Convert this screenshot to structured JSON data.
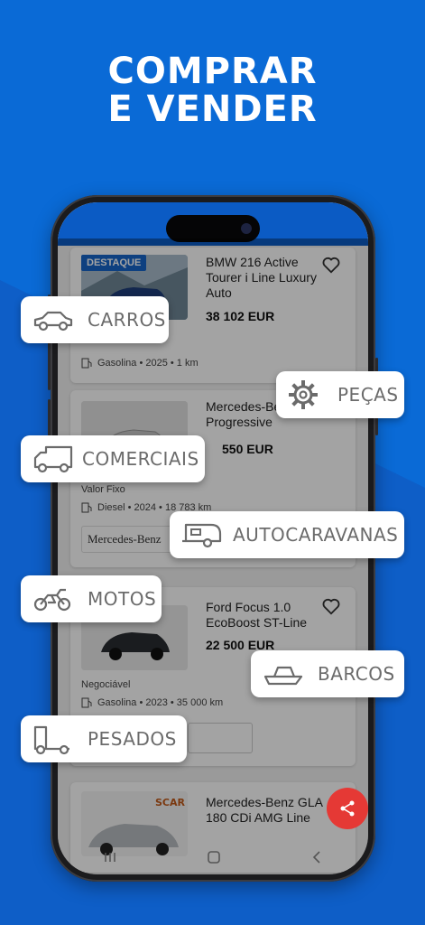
{
  "headline": {
    "line1": "COMPRAR",
    "line2": "E VENDER"
  },
  "colors": {
    "background": "#0a6ad6",
    "brand_blue": "#1665c9",
    "fab_red": "#e53935"
  },
  "listings": [
    {
      "badge": "DESTAQUE",
      "title": "BMW 216 Active Tourer i Line Luxury Auto",
      "price": "38 102 EUR",
      "details": "Gasolina • 2025 • 1 km"
    },
    {
      "title": "Mercedes-Benz 180 d Progressive",
      "price": "550 EUR",
      "price_note": "Valor Fixo",
      "details": "Diesel • 2024 • 18 783 km",
      "dealer": "Mercedes-Benz"
    },
    {
      "title": "Ford Focus 1.0 EcoBoost ST-Line",
      "price": "22 500 EUR",
      "price_note": "Negociável",
      "details": "Gasolina • 2023 • 35 000 km"
    },
    {
      "title": "Mercedes-Benz GLA 180 CDi AMG Line",
      "dealer": "SCAR"
    }
  ],
  "categories": [
    {
      "label": "CARROS",
      "icon": "car-icon"
    },
    {
      "label": "PEÇAS",
      "icon": "gear-icon"
    },
    {
      "label": "COMERCIAIS",
      "icon": "van-icon"
    },
    {
      "label": "AUTOCARAVANAS",
      "icon": "caravan-icon"
    },
    {
      "label": "MOTOS",
      "icon": "motorcycle-icon"
    },
    {
      "label": "BARCOS",
      "icon": "boat-icon"
    },
    {
      "label": "PESADOS",
      "icon": "truck-icon"
    }
  ],
  "nav": {
    "items": [
      "menu-icon",
      "home-icon",
      "back-icon"
    ]
  }
}
